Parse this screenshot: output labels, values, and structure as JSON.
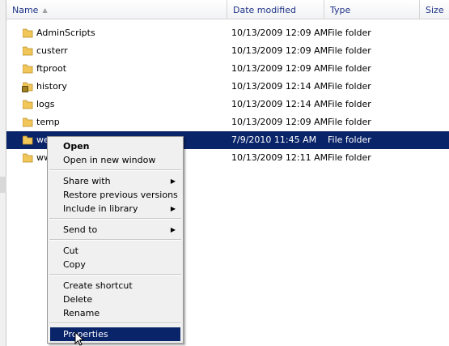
{
  "columns": {
    "name": "Name",
    "date": "Date modified",
    "type": "Type",
    "size": "Size"
  },
  "rows": [
    {
      "name": "AdminScripts",
      "date": "10/13/2009 12:09 AM",
      "type": "File folder"
    },
    {
      "name": "custerr",
      "date": "10/13/2009 12:09 AM",
      "type": "File folder"
    },
    {
      "name": "ftproot",
      "date": "10/13/2009 12:09 AM",
      "type": "File folder"
    },
    {
      "name": "history",
      "date": "10/13/2009 12:14 AM",
      "type": "File folder"
    },
    {
      "name": "logs",
      "date": "10/13/2009 12:14 AM",
      "type": "File folder"
    },
    {
      "name": "temp",
      "date": "10/13/2009 12:09 AM",
      "type": "File folder"
    },
    {
      "name": "we",
      "date": "7/9/2010 11:45 AM",
      "type": "File folder"
    },
    {
      "name": "ww",
      "date": "10/13/2009 12:11 AM",
      "type": "File folder"
    }
  ],
  "context_menu": {
    "open": "Open",
    "open_new_window": "Open in new window",
    "share_with": "Share with",
    "restore_previous": "Restore previous versions",
    "include_library": "Include in library",
    "send_to": "Send to",
    "cut": "Cut",
    "copy": "Copy",
    "create_shortcut": "Create shortcut",
    "delete": "Delete",
    "rename": "Rename",
    "properties": "Properties"
  },
  "colors": {
    "selection": "#0a246a",
    "header_text": "#1e3287",
    "folder": "#f2c75a"
  },
  "icons": {
    "folder": "folder-icon",
    "sort": "sort-ascending-icon",
    "submenu": "submenu-arrow-icon",
    "cursor": "mouse-pointer-icon"
  }
}
